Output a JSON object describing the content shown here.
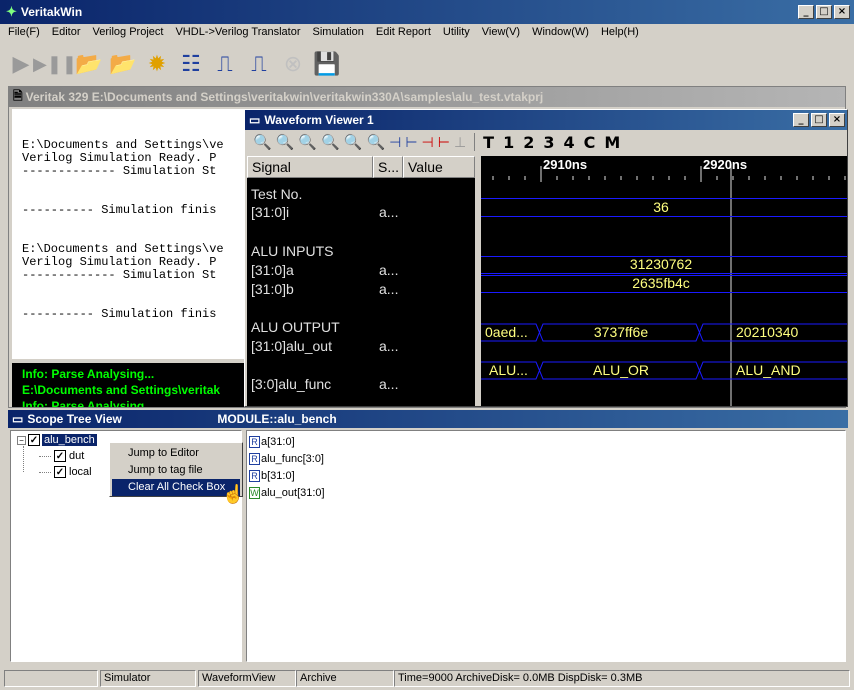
{
  "app": {
    "title": "VeritakWin"
  },
  "menu": [
    "File(F)",
    "Editor",
    "Verilog Project",
    "VHDL->Verilog Translator",
    "Simulation",
    "Edit Report",
    "Utility",
    "View(V)",
    "Window(W)",
    "Help(H)"
  ],
  "toolbar": {
    "icons": [
      "play-icon",
      "step-icon",
      "open-project-icon",
      "compile-run-icon",
      "gear-icon",
      "hierarchy-icon",
      "waveform-icon",
      "add-signal-icon",
      "stop-icon",
      "save-icon"
    ]
  },
  "project": {
    "title": "Veritak 329 E:\\Documents and Settings\\veritakwin\\veritakwin330A\\samples\\alu_test.vtakprj"
  },
  "console": {
    "lines": [
      "",
      "",
      "E:\\Documents and Settings\\ve",
      "Verilog Simulation Ready. P",
      "------------- Simulation St",
      "",
      "",
      "---------- Simulation finis",
      "",
      "",
      "E:\\Documents and Settings\\ve",
      "Verilog Simulation Ready. P",
      "------------- Simulation St",
      "",
      "",
      "---------- Simulation finis"
    ],
    "info": [
      "Info: Parse Analysing...",
      "E:\\Documents and Settings\\veritak",
      "Info: Parse Analysing..."
    ]
  },
  "wave": {
    "title": "Waveform Viewer 1",
    "tool_letters": [
      "T",
      "1",
      "2",
      "3",
      "4",
      "C",
      "M"
    ],
    "headers": {
      "signal": "Signal",
      "s": "S...",
      "value": "Value"
    },
    "time_labels": [
      "2910ns",
      "2920ns"
    ],
    "rows": [
      {
        "name": "Test No.",
        "s": ""
      },
      {
        "name": "[31:0]i",
        "s": "a..."
      },
      {
        "name": "ALU INPUTS",
        "s": ""
      },
      {
        "name": "[31:0]a",
        "s": "a..."
      },
      {
        "name": "[31:0]b",
        "s": "a..."
      },
      {
        "name": " ALU OUTPUT",
        "s": ""
      },
      {
        "name": "[31:0]alu_out",
        "s": "a..."
      },
      {
        "name": "[3:0]alu_func",
        "s": "a..."
      }
    ],
    "values": {
      "i": "36",
      "a": "31230762",
      "b": "2635fb4c",
      "out1": "0aed...",
      "out2": "3737ff6e",
      "out3": "20210340",
      "func1": "ALU...",
      "func2": "ALU_OR",
      "func3": "ALU_AND"
    }
  },
  "scope": {
    "title": "Scope Tree View",
    "module": "MODULE::alu_bench",
    "tree": {
      "root": "alu_bench",
      "children": [
        "dut",
        "local"
      ]
    },
    "menu": [
      "Jump to Editor",
      "Jump to tag file",
      "Clear All Check Box"
    ],
    "signals": [
      {
        "badge": "R",
        "name": "a[31:0]"
      },
      {
        "badge": "R",
        "name": "alu_func[3:0]"
      },
      {
        "badge": "R",
        "name": "b[31:0]"
      },
      {
        "badge": "W",
        "name": "alu_out[31:0]"
      }
    ]
  },
  "status": [
    "",
    "Simulator",
    "WaveformView",
    "Archive",
    "Time=9000 ArchiveDisk= 0.0MB DispDisk= 0.3MB"
  ],
  "colors": {
    "accent": "#0a246a",
    "bus": "#1a1aff",
    "wave_text": "#ffff80",
    "info": "#00ff00"
  }
}
